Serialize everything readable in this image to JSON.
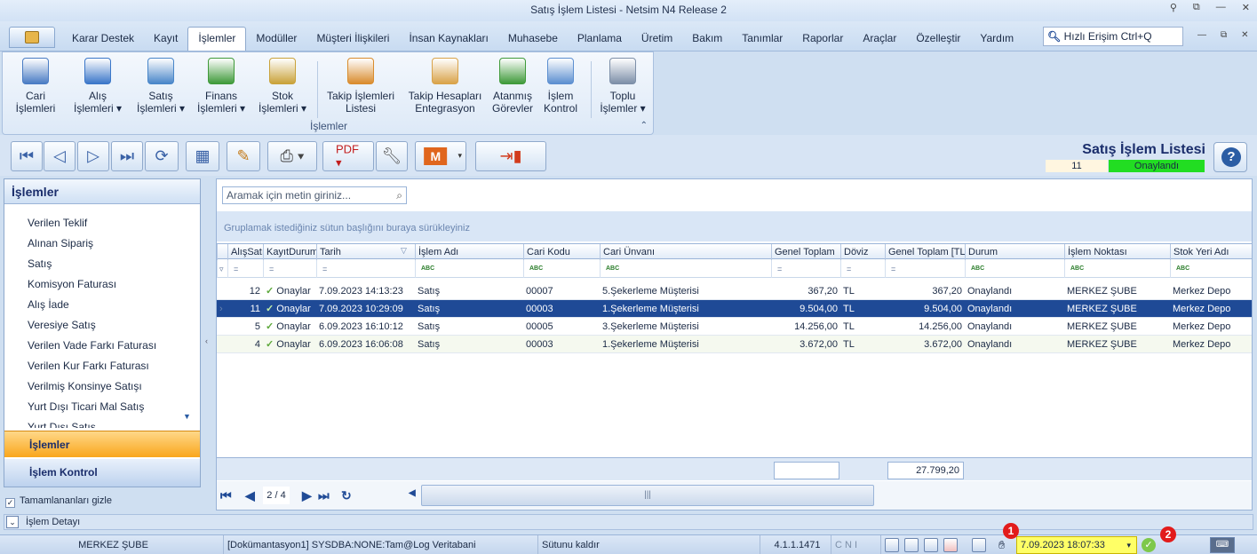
{
  "window": {
    "title": "Satış İşlem Listesi - Netsim N4 Release 2"
  },
  "menu": {
    "tabs": [
      "Karar Destek",
      "Kayıt",
      "İşlemler",
      "Modüller",
      "Müşteri İlişkileri",
      "İnsan Kaynakları",
      "Muhasebe",
      "Planlama",
      "Üretim",
      "Bakım",
      "Tanımlar",
      "Raporlar",
      "Araçlar",
      "Özelleştir",
      "Yardım"
    ],
    "active": "İşlemler",
    "quick_access": "Hızlı Erişim Ctrl+Q"
  },
  "ribbon": {
    "group_label": "İşlemler",
    "buttons": [
      "Cari\nİşlemleri",
      "Alış\nİşlemleri ▾",
      "Satış\nİşlemleri ▾",
      "Finans\nİşlemleri ▾",
      "Stok\nİşlemleri ▾",
      "Takip İşlemleri\nListesi",
      "Takip Hesapları\nEntegrasyon",
      "Atanmış\nGörevler",
      "İşlem\nKontrol",
      "Toplu\nİşlemler ▾"
    ]
  },
  "header": {
    "title": "Satış İşlem Listesi",
    "count": "11",
    "status": "Onaylandı",
    "status_color": "#22dd22"
  },
  "left_panel": {
    "title": "İşlemler",
    "items": [
      "Verilen Teklif",
      "Alınan Sipariş",
      "Satış",
      "Komisyon Faturası",
      "Alış İade",
      "Veresiye Satış",
      "Verilen Vade Farkı Faturası",
      "Verilen Kur Farkı Faturası",
      "Verilmiş Konsinye Satışı",
      "Yurt Dışı Ticari Mal Satış",
      "Yurt Dışı Satış"
    ],
    "selected_section": "İşlemler",
    "section2": "İşlem Kontrol",
    "hide_completed": "Tamamlananları gizle"
  },
  "grid": {
    "search_placeholder": "Aramak için metin giriniz...",
    "group_hint": "Gruplamak istediğiniz sütun başlığını buraya sürükleyiniz",
    "columns": [
      "AlışSatış",
      "KayıtDurum",
      "Tarih",
      "İşlem Adı",
      "Cari Kodu",
      "Cari Ünvanı",
      "Genel Toplam",
      "Döviz",
      "Genel Toplam [TL]",
      "Durum",
      "İşlem Noktası",
      "Stok Yeri Adı"
    ],
    "filter_symbols": [
      "=",
      "=",
      "=",
      "ABC",
      "ABC",
      "ABC",
      "=",
      "=",
      "=",
      "ABC",
      "ABC",
      "ABC"
    ],
    "rows": [
      {
        "no": "12",
        "kayit": "Onaylar",
        "tarih": "7.09.2023 14:13:23",
        "islem": "Satış",
        "cari_kodu": "00007",
        "cari_unvan": "5.Şekerleme Müşterisi",
        "genel_toplam": "367,20",
        "doviz": "TL",
        "genel_toplam_tl": "367,20",
        "durum": "Onaylandı",
        "islem_noktasi": "MERKEZ ŞUBE",
        "stok_yeri": "Merkez Depo"
      },
      {
        "no": "11",
        "kayit": "Onaylar",
        "tarih": "7.09.2023 10:29:09",
        "islem": "Satış",
        "cari_kodu": "00003",
        "cari_unvan": "1.Şekerleme Müşterisi",
        "genel_toplam": "9.504,00",
        "doviz": "TL",
        "genel_toplam_tl": "9.504,00",
        "durum": "Onaylandı",
        "islem_noktasi": "MERKEZ ŞUBE",
        "stok_yeri": "Merkez Depo"
      },
      {
        "no": "5",
        "kayit": "Onaylar",
        "tarih": "6.09.2023 16:10:12",
        "islem": "Satış",
        "cari_kodu": "00005",
        "cari_unvan": "3.Şekerleme Müşterisi",
        "genel_toplam": "14.256,00",
        "doviz": "TL",
        "genel_toplam_tl": "14.256,00",
        "durum": "Onaylandı",
        "islem_noktasi": "MERKEZ ŞUBE",
        "stok_yeri": "Merkez Depo"
      },
      {
        "no": "4",
        "kayit": "Onaylar",
        "tarih": "6.09.2023 16:06:08",
        "islem": "Satış",
        "cari_kodu": "00003",
        "cari_unvan": "1.Şekerleme Müşterisi",
        "genel_toplam": "3.672,00",
        "doviz": "TL",
        "genel_toplam_tl": "3.672,00",
        "durum": "Onaylandı",
        "islem_noktasi": "MERKEZ ŞUBE",
        "stok_yeri": "Merkez Depo"
      }
    ],
    "footer_total": "27.799,20",
    "page": "2 / 4"
  },
  "detail": {
    "label": "İşlem Detayı"
  },
  "statusbar": {
    "branch": "MERKEZ ŞUBE",
    "connection": "[Dokümantasyon1] SYSDBA:NONE:Tam@Log Veritabani",
    "message": "Sütunu kaldır",
    "version": "4.1.1.1471",
    "mode": "C  N  I",
    "datetime": "7.09.2023 18:07:33",
    "badge1": "1",
    "badge2": "2"
  }
}
